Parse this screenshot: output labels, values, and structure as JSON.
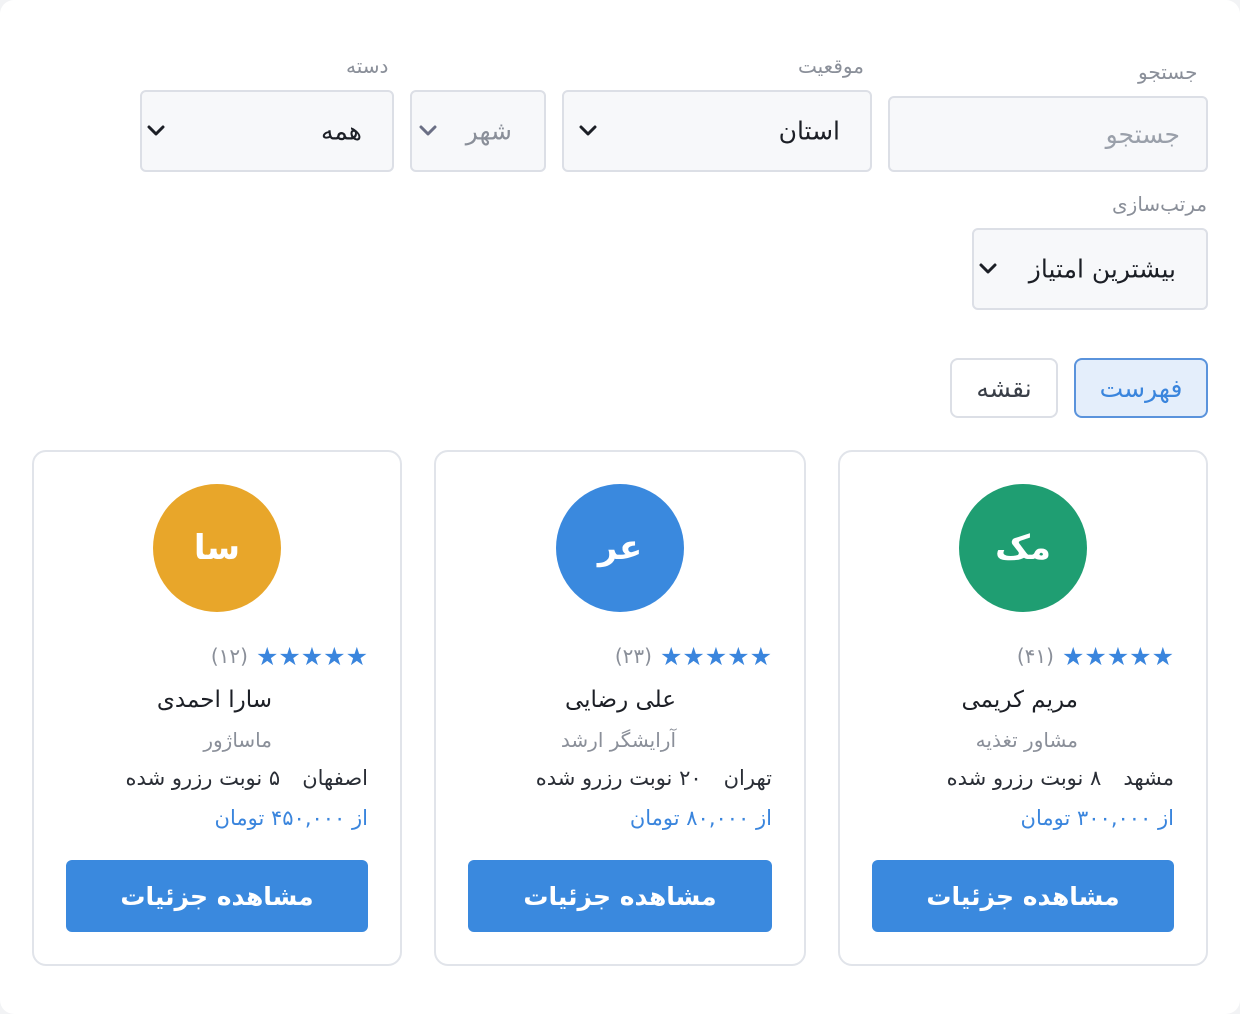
{
  "filters": {
    "search": {
      "label": "جستجو",
      "placeholder": "جستجو",
      "value": ""
    },
    "location": {
      "label": "موقعیت",
      "province": "استان",
      "city": "شهر"
    },
    "category": {
      "label": "دسته",
      "value": "همه"
    },
    "sort": {
      "label": "مرتب‌سازی",
      "value": "بیشترین امتیاز"
    }
  },
  "view_toggle": {
    "list_label": "فهرست",
    "map_label": "نقشه",
    "active": "list"
  },
  "icons": {
    "dropdown": "chevron-down-icon",
    "rating": "star-icon"
  },
  "colors": {
    "accent": "#3a89de",
    "active_toggle_bg": "#e4eefb"
  },
  "providers": [
    {
      "initials": "مک",
      "avatar_color": "#1f9e72",
      "stars": "★★★★★",
      "reviews": "(۴۱)",
      "name": "مریم کریمی",
      "title": "مشاور تغذیه",
      "city": "مشهد",
      "bookings": "۸ نوبت رزرو شده",
      "price": "از ۳۰۰,۰۰۰ تومان",
      "button": "مشاهده جزئیات"
    },
    {
      "initials": "عر",
      "avatar_color": "#3a89de",
      "stars": "★★★★★",
      "reviews": "(۲۳)",
      "name": "علی رضایی",
      "title": "آرایشگر ارشد",
      "city": "تهران",
      "bookings": "۲۰ نوبت رزرو شده",
      "price": "از ۸۰,۰۰۰ تومان",
      "button": "مشاهده جزئیات"
    },
    {
      "initials": "سا",
      "avatar_color": "#e8a62a",
      "stars": "★★★★★",
      "reviews": "(۱۲)",
      "name": "سارا احمدی",
      "title": "ماساژور",
      "city": "اصفهان",
      "bookings": "۵ نوبت رزرو شده",
      "price": "از ۴۵۰,۰۰۰ تومان",
      "button": "مشاهده جزئیات"
    }
  ]
}
